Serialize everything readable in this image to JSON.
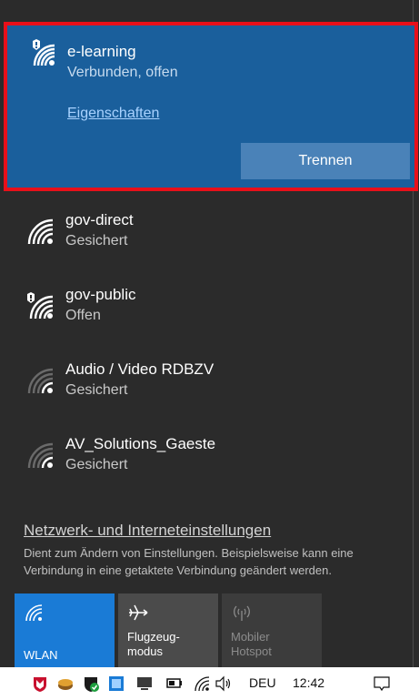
{
  "selected_network": {
    "name": "e-learning",
    "status": "Verbunden, offen",
    "properties_link": "Eigenschaften",
    "disconnect_button": "Trennen",
    "icon": "wifi-secure-warning-icon"
  },
  "networks": [
    {
      "name": "gov-direct",
      "status": "Gesichert",
      "icon": "wifi-icon"
    },
    {
      "name": "gov-public",
      "status": "Offen",
      "icon": "wifi-shield-warning-icon"
    },
    {
      "name": "Audio / Video RDBZV",
      "status": "Gesichert",
      "icon": "wifi-weak-icon"
    },
    {
      "name": "AV_Solutions_Gaeste",
      "status": "Gesichert",
      "icon": "wifi-weak-icon"
    }
  ],
  "settings": {
    "link": "Netzwerk- und Interneteinstellungen",
    "description": "Dient zum Ändern von Einstellungen. Beispielsweise kann eine Verbindung in eine getaktete Verbindung geändert werden."
  },
  "quick_actions": [
    {
      "label": "WLAN",
      "icon": "wifi-icon",
      "active": true
    },
    {
      "label": "Flugzeug-\nmodus",
      "icon": "airplane-icon",
      "active": false
    },
    {
      "label": "Mobiler\nHotspot",
      "icon": "hotspot-icon",
      "active": false,
      "disabled": true
    }
  ],
  "taskbar": {
    "language": "DEU",
    "time": "12:42"
  },
  "colors": {
    "selected_bg": "#1a5f9c",
    "highlight_border": "#e8101a",
    "flyout_bg": "#2b2b2b",
    "wlan_tile": "#1a7bd6"
  }
}
